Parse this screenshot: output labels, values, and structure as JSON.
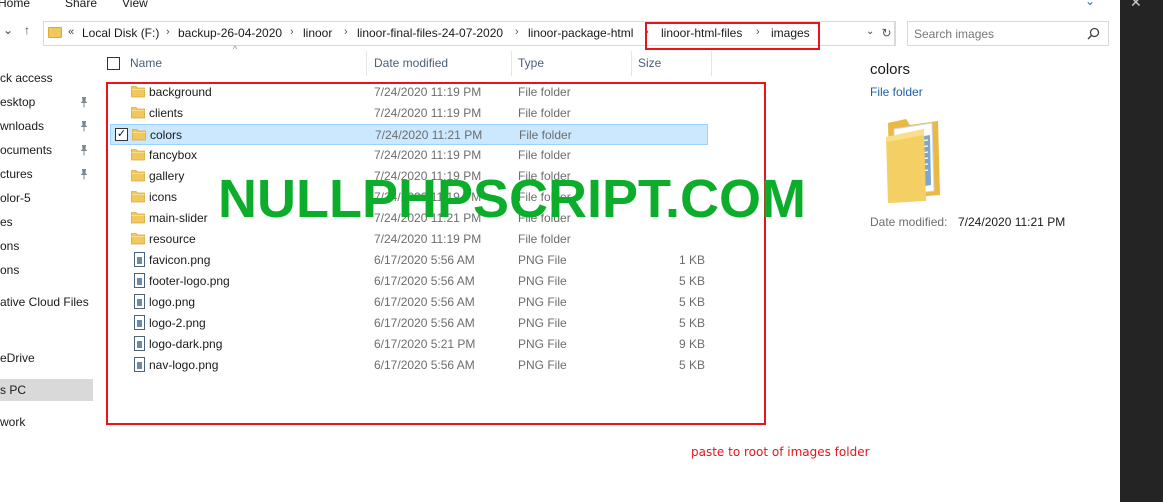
{
  "ribbon": {
    "tabs": [
      "Home",
      "Share",
      "View"
    ]
  },
  "address": {
    "overflow": "«",
    "breadcrumbs": [
      "Local Disk (F:)",
      "backup-26-04-2020",
      "linoor",
      "linoor-final-files-24-07-2020",
      "linoor-package-html",
      "linoor-html-files",
      "images"
    ],
    "separator": "›"
  },
  "search": {
    "placeholder": "Search images"
  },
  "nav_pane": {
    "items": [
      {
        "label": "ck access",
        "pinned": false
      },
      {
        "label": "esktop",
        "pinned": true
      },
      {
        "label": "wnloads",
        "pinned": true
      },
      {
        "label": "ocuments",
        "pinned": true
      },
      {
        "label": "ctures",
        "pinned": true
      },
      {
        "label": "olor-5",
        "pinned": false
      },
      {
        "label": "es",
        "pinned": false
      },
      {
        "label": "ons",
        "pinned": false
      },
      {
        "label": "ons",
        "pinned": false
      },
      {
        "label": "ative Cloud Files",
        "pinned": false
      },
      {
        "label": "eDrive",
        "pinned": false
      },
      {
        "label": "s PC",
        "pinned": false,
        "selected": true
      },
      {
        "label": "work",
        "pinned": false
      }
    ]
  },
  "columns": {
    "name": "Name",
    "date": "Date modified",
    "type": "Type",
    "size": "Size"
  },
  "files": [
    {
      "name": "background",
      "date": "7/24/2020 11:19 PM",
      "type": "File folder",
      "size": "",
      "kind": "folder"
    },
    {
      "name": "clients",
      "date": "7/24/2020 11:19 PM",
      "type": "File folder",
      "size": "",
      "kind": "folder"
    },
    {
      "name": "colors",
      "date": "7/24/2020 11:21 PM",
      "type": "File folder",
      "size": "",
      "kind": "folder",
      "selected": true
    },
    {
      "name": "fancybox",
      "date": "7/24/2020 11:19 PM",
      "type": "File folder",
      "size": "",
      "kind": "folder"
    },
    {
      "name": "gallery",
      "date": "7/24/2020 11:19 PM",
      "type": "File folder",
      "size": "",
      "kind": "folder"
    },
    {
      "name": "icons",
      "date": "7/24/2020 11:19 PM",
      "type": "File folder",
      "size": "",
      "kind": "folder"
    },
    {
      "name": "main-slider",
      "date": "7/24/2020 11:21 PM",
      "type": "File folder",
      "size": "",
      "kind": "folder"
    },
    {
      "name": "resource",
      "date": "7/24/2020 11:19 PM",
      "type": "File folder",
      "size": "",
      "kind": "folder"
    },
    {
      "name": "favicon.png",
      "date": "6/17/2020 5:56 AM",
      "type": "PNG File",
      "size": "1 KB",
      "kind": "file"
    },
    {
      "name": "footer-logo.png",
      "date": "6/17/2020 5:56 AM",
      "type": "PNG File",
      "size": "5 KB",
      "kind": "file"
    },
    {
      "name": "logo.png",
      "date": "6/17/2020 5:56 AM",
      "type": "PNG File",
      "size": "5 KB",
      "kind": "file"
    },
    {
      "name": "logo-2.png",
      "date": "6/17/2020 5:56 AM",
      "type": "PNG File",
      "size": "5 KB",
      "kind": "file"
    },
    {
      "name": "logo-dark.png",
      "date": "6/17/2020 5:21 PM",
      "type": "PNG File",
      "size": "9 KB",
      "kind": "file"
    },
    {
      "name": "nav-logo.png",
      "date": "6/17/2020 5:56 AM",
      "type": "PNG File",
      "size": "5 KB",
      "kind": "file"
    }
  ],
  "watermark": "NULLPHPSCRIPT.COM",
  "annotation": "paste to root of images folder",
  "details": {
    "title": "colors",
    "type": "File folder",
    "date_label": "Date modified:",
    "date_value": "7/24/2020 11:21 PM"
  },
  "colors": {
    "selection": "#cce8ff",
    "highlight_red": "#e8141a",
    "watermark_green": "#0dad2c",
    "folder_yellow": "#f1c85e"
  }
}
